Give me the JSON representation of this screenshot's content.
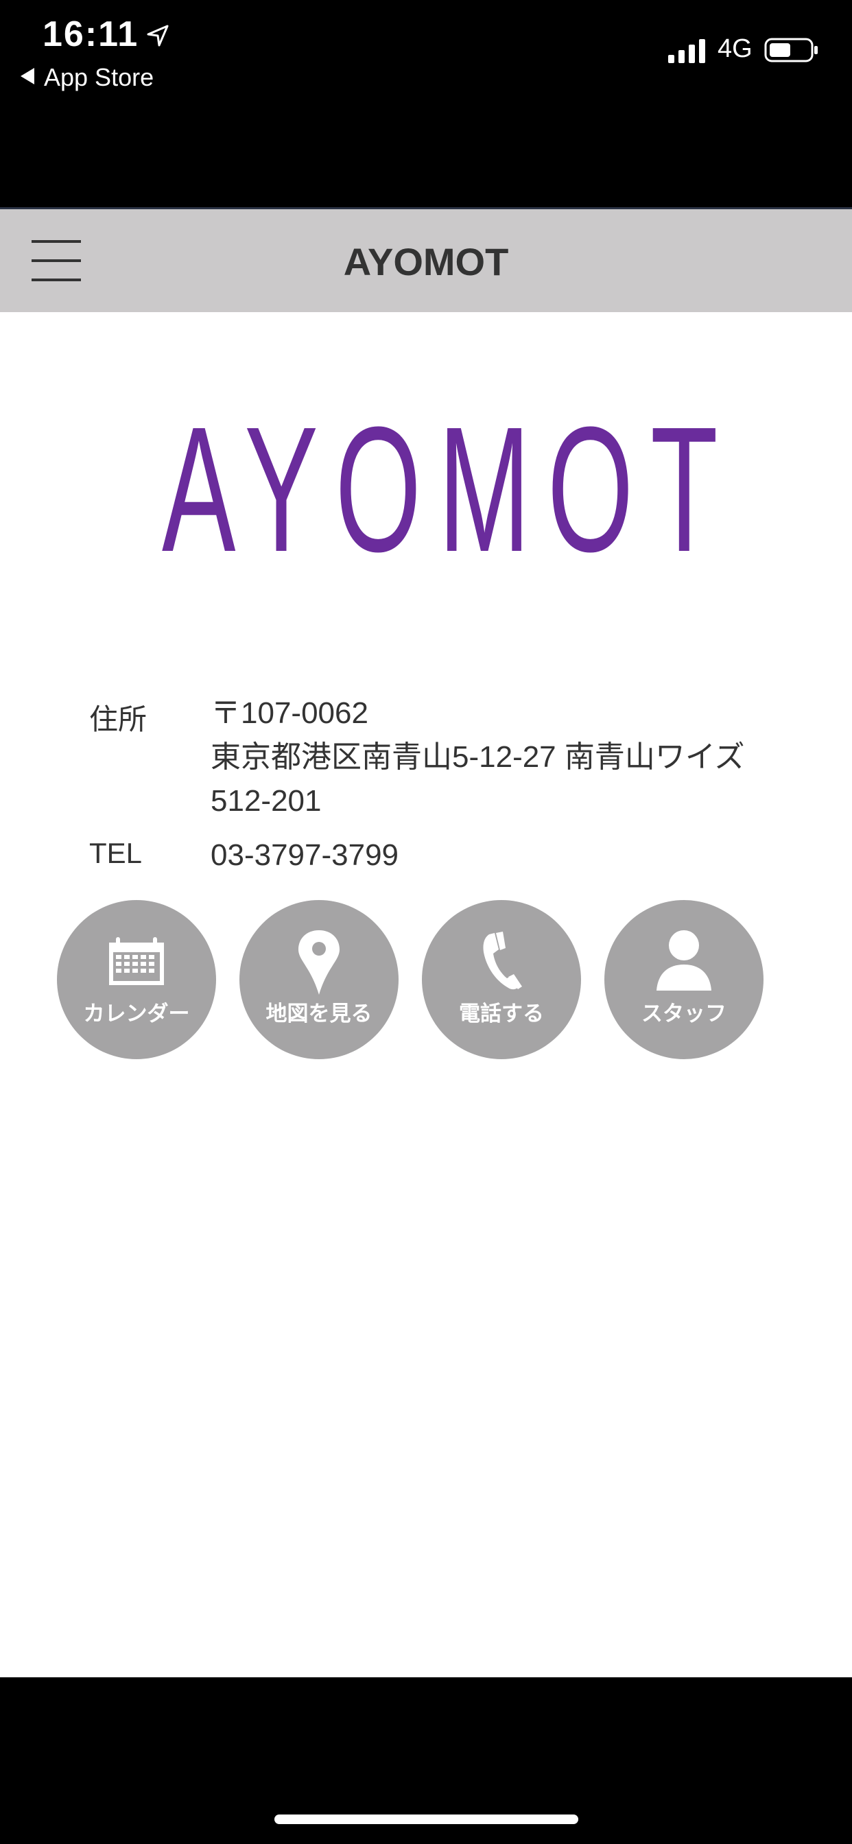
{
  "status_bar": {
    "time": "16:11",
    "back_app": "App Store",
    "network": "4G"
  },
  "header": {
    "title": "AYOMOT"
  },
  "logo": {
    "text": "AYOMOT",
    "color": "#6a2c9c"
  },
  "info": {
    "address_label": "住所",
    "postal": "〒107-0062",
    "address_line1": "東京都港区南青山5-12-27 南青山ワイズ",
    "address_line2": "512-201",
    "tel_label": "TEL",
    "tel": "03-3797-3799"
  },
  "actions": [
    {
      "label": "カレンダー",
      "icon": "calendar-icon"
    },
    {
      "label": "地図を見る",
      "icon": "map-pin-icon"
    },
    {
      "label": "電話する",
      "icon": "phone-icon"
    },
    {
      "label": "スタッフ",
      "icon": "person-icon"
    }
  ]
}
